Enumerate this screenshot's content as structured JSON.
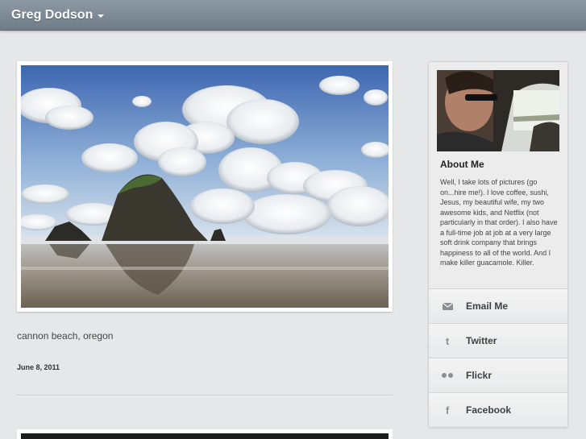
{
  "header": {
    "site_title": "Greg Dodson"
  },
  "post": {
    "caption": "cannon beach, oregon",
    "date": "June 8, 2011"
  },
  "sidebar": {
    "about_title": "About Me",
    "about_text": "Well, I take lots of pictures (go on...hire me!). I love coffee, sushi, Jesus, my beautiful wife, my two awesome kids, and Netflix (not particularly in that order). I also have a full-time job at job at a very large soft drink company that brings happiness to all of the world. And I make killer guacamole. Killer.",
    "links": [
      {
        "label": "Email Me",
        "icon": "mail-icon"
      },
      {
        "label": "Twitter",
        "icon": "twitter-icon"
      },
      {
        "label": "Flickr",
        "icon": "flickr-icon"
      },
      {
        "label": "Facebook",
        "icon": "facebook-icon"
      }
    ]
  },
  "colors": {
    "header_bar": "#7f8c98",
    "page_background": "#e6e7e8",
    "sidebar_background": "#ececec"
  }
}
